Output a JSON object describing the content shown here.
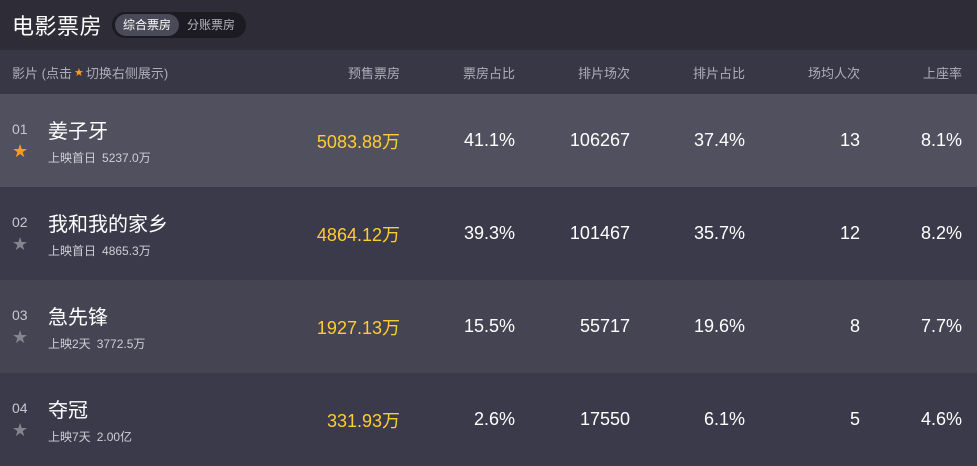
{
  "header": {
    "title": "电影票房",
    "tabs": [
      {
        "label": "综合票房",
        "active": true
      },
      {
        "label": "分账票房",
        "active": false
      }
    ]
  },
  "columns": {
    "film_prefix": "影片 (点击",
    "film_suffix": "切换右侧展示)",
    "presale": "预售票房",
    "box_share": "票房占比",
    "shows": "排片场次",
    "show_share": "排片占比",
    "avg_people": "场均人次",
    "occupancy": "上座率"
  },
  "colors": {
    "accent_gold": "#ffcc33",
    "star_active": "#ff9a1f",
    "star_inactive": "#85848f"
  },
  "rows": [
    {
      "rank": "01",
      "starred": true,
      "name": "姜子牙",
      "release": "上映首日",
      "total": "5237.0万",
      "presale": "5083.88万",
      "box_share": "41.1%",
      "shows": "106267",
      "show_share": "37.4%",
      "avg_people": "13",
      "occupancy": "8.1%"
    },
    {
      "rank": "02",
      "starred": false,
      "name": "我和我的家乡",
      "release": "上映首日",
      "total": "4865.3万",
      "presale": "4864.12万",
      "box_share": "39.3%",
      "shows": "101467",
      "show_share": "35.7%",
      "avg_people": "12",
      "occupancy": "8.2%"
    },
    {
      "rank": "03",
      "starred": false,
      "name": "急先锋",
      "release": "上映2天",
      "total": "3772.5万",
      "presale": "1927.13万",
      "box_share": "15.5%",
      "shows": "55717",
      "show_share": "19.6%",
      "avg_people": "8",
      "occupancy": "7.7%"
    },
    {
      "rank": "04",
      "starred": false,
      "name": "夺冠",
      "release": "上映7天",
      "total": "2.00亿",
      "presale": "331.93万",
      "box_share": "2.6%",
      "shows": "17550",
      "show_share": "6.1%",
      "avg_people": "5",
      "occupancy": "4.6%"
    }
  ]
}
